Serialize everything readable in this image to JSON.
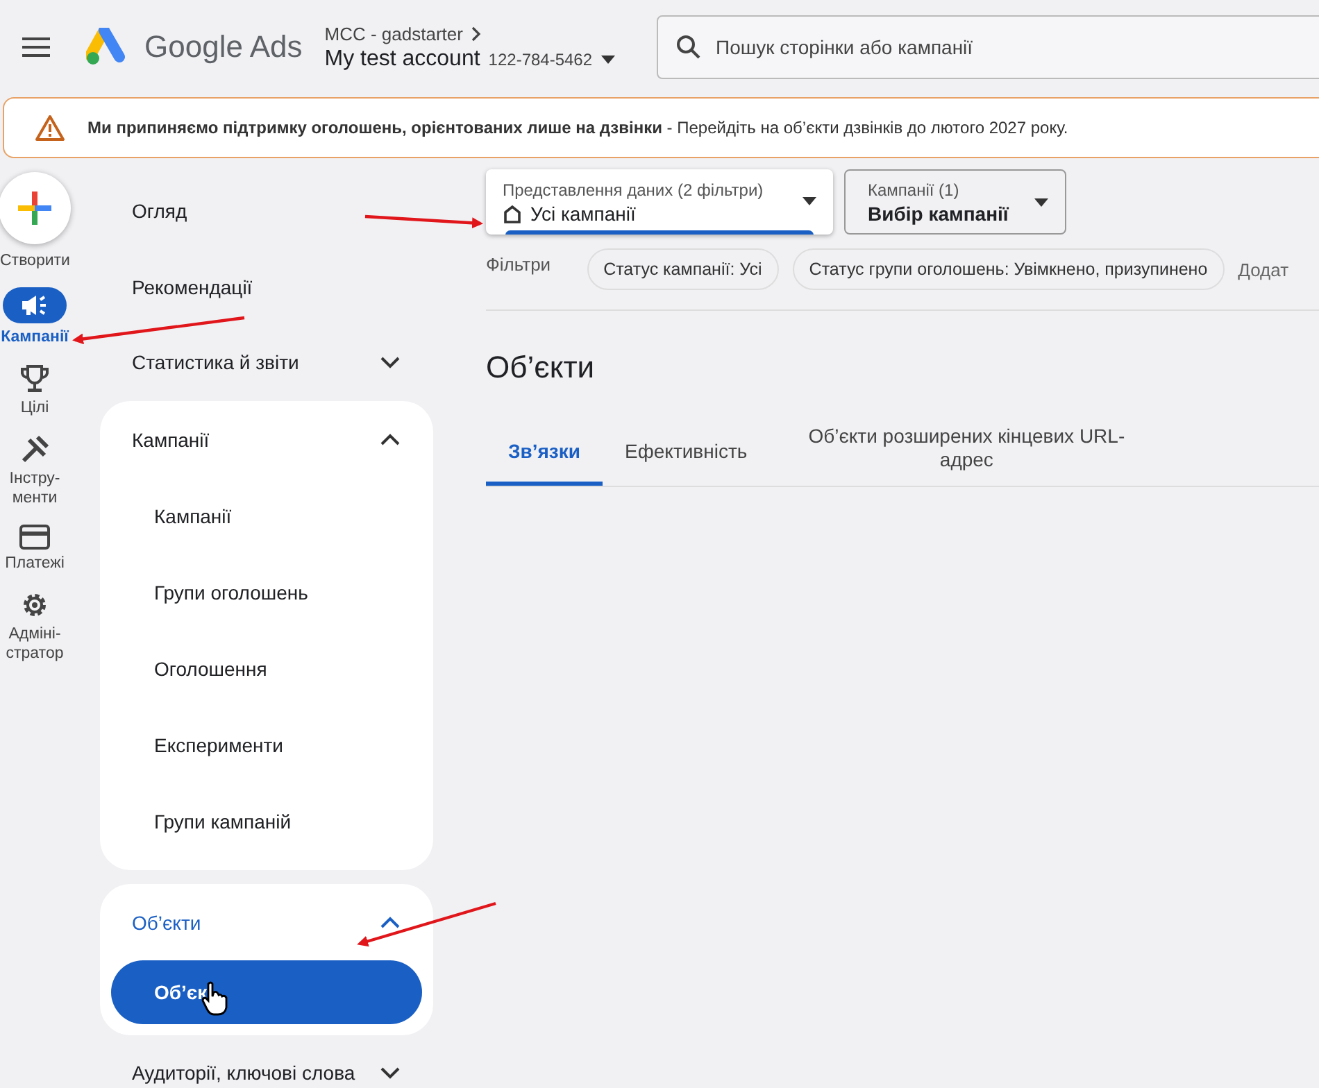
{
  "header": {
    "product": "Google Ads",
    "manager": "MCC - gadstarter",
    "account": "My test account",
    "account_id": "122-784-5462",
    "search": {
      "placeholder": "Пошук сторінки або кампанії"
    }
  },
  "banner": {
    "text": "**Ми припиняємо підтримку оголошень, орієнтованих лише на дзвінки** - Перейдіть на об’єкти дзвінків до лютого 2027 року."
  },
  "rail": [
    {
      "label": "Створити",
      "kind": "create",
      "selected": false
    },
    {
      "label": "Кампанії",
      "kind": "campaigns",
      "selected": true
    },
    {
      "label": "Цілі",
      "kind": "goals",
      "selected": false
    },
    {
      "label": "Інстру-менти",
      "kind": "tools",
      "selected": false
    },
    {
      "label": "Платежі",
      "kind": "billing",
      "selected": false
    },
    {
      "label": "Адміні-стратор",
      "kind": "admin",
      "selected": false
    }
  ],
  "nav": [
    {
      "label": "Огляд",
      "kind": "link"
    },
    {
      "label": "Рекомендації",
      "kind": "link"
    },
    {
      "label": "Статистика й звіти",
      "kind": "group",
      "expanded": false
    },
    {
      "label": "Кампанії",
      "kind": "group",
      "expanded": true,
      "selected": false,
      "children": [
        {
          "label": "Кампанії",
          "selected": false
        },
        {
          "label": "Групи оголошень",
          "selected": false
        },
        {
          "label": "Оголошення",
          "selected": false
        },
        {
          "label": "Експерименти",
          "selected": false
        },
        {
          "label": "Групи кампаній",
          "selected": false
        }
      ]
    },
    {
      "label": "Об’єкти",
      "kind": "group",
      "expanded": true,
      "selected": true,
      "children": [
        {
          "label": "Об’єк",
          "selected": true
        }
      ]
    },
    {
      "label": "Аудиторії, ключові слова",
      "kind": "group",
      "expanded": false
    }
  ],
  "view_selector": {
    "label": "Представлення даних (2 фільтри)",
    "value": "Усі кампанії"
  },
  "campaign_selector": {
    "label": "Кампанії (1)",
    "value": "Вибір кампанії"
  },
  "filters": {
    "label": "Фільтри",
    "chips": [
      "Статус кампанії: Усі",
      "Статус групи оголошень: Увімкнено, призупинено"
    ],
    "add": "Додат"
  },
  "page_title": "Об’єкти",
  "tabs": [
    {
      "label": "Зв’язки",
      "selected": true
    },
    {
      "label": "Ефективність",
      "selected": false
    },
    {
      "label": "Об’єкти розширених кінцевих URL-адрес",
      "selected": false
    }
  ]
}
